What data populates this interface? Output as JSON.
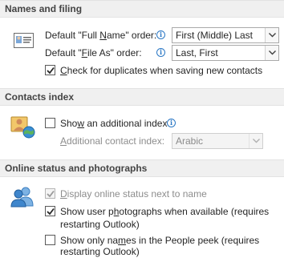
{
  "names_filing": {
    "header": "Names and filing",
    "full_name_label_pre": "Default \"Full ",
    "full_name_label_u": "N",
    "full_name_label_post": "ame\" order:",
    "full_name_value": "First (Middle) Last",
    "file_as_label_pre": "Default \"",
    "file_as_label_u": "F",
    "file_as_label_post": "ile As\" order:",
    "file_as_value": "Last, First",
    "duplicates_label_pre": "",
    "duplicates_label_u": "C",
    "duplicates_label_post": "heck for duplicates when saving new contacts",
    "duplicates_checked": true
  },
  "contacts_index": {
    "header": "Contacts index",
    "show_index_pre": "Sho",
    "show_index_u": "w",
    "show_index_post": " an additional index",
    "show_index_checked": false,
    "additional_label_pre": "",
    "additional_label_u": "A",
    "additional_label_post": "dditional contact index:",
    "additional_value": "Arabic"
  },
  "online_status": {
    "header": "Online status and photographs",
    "display_status_pre": "",
    "display_status_u": "D",
    "display_status_post": "isplay online status next to name",
    "display_status_checked": true,
    "show_photos_pre": "Show user p",
    "show_photos_u": "h",
    "show_photos_post": "otographs when available (requires",
    "show_photos_line2": "restarting Outlook)",
    "show_photos_checked": true,
    "show_names_pre": "Show only na",
    "show_names_u": "m",
    "show_names_post": "es in the People peek (requires",
    "show_names_line2": "restarting Outlook)",
    "show_names_checked": false
  },
  "icons": {
    "names": "contact-card-icon",
    "index": "contacts-globe-icon",
    "status": "people-icon",
    "info": "info-icon",
    "dropdown": "chevron-down-icon",
    "check": "checkmark-icon"
  },
  "colors": {
    "accent": "#2b78c5",
    "header_bg": "#f0f0f0",
    "disabled_text": "#8d8d8d"
  }
}
